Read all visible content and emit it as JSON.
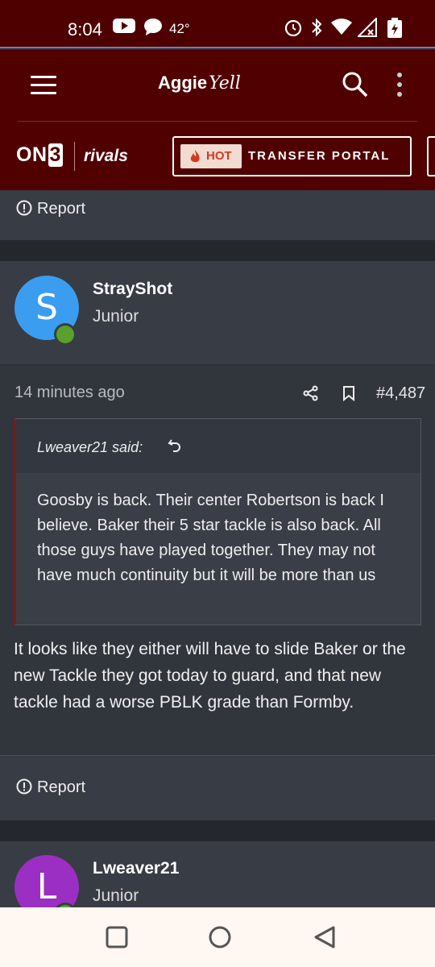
{
  "status_bar": {
    "time": "8:04",
    "temperature": "42°",
    "icons": [
      "youtube-icon",
      "chat-icon",
      "alarm-icon",
      "bluetooth-icon",
      "wifi-icon",
      "signal-icon",
      "battery-icon"
    ]
  },
  "header": {
    "logo_part1": "Aggie",
    "logo_part2": "Yell",
    "on3_text": "ON",
    "on3_digit": "3",
    "rivals_text": "rivals",
    "hot_badge": "HOT",
    "portal_label": "TRANSFER PORTAL"
  },
  "report_label": "Report",
  "posts": [
    {
      "username": "StrayShot",
      "rank": "Junior",
      "avatar_letter": "S",
      "avatar_color": "#3a9df0",
      "time_ago": "14 minutes ago",
      "post_number": "#4,487",
      "quote": {
        "author": "Lweaver21 said:",
        "text": "Goosby is back. Their center Robertson is back I believe. Baker their 5 star tackle is also back. All those guys have played together. They may not have much continuity but it will be more than us"
      },
      "body": "It looks like they either will have to slide Baker or the new Tackle they got today to guard, and that new tackle had a worse PBLK grade than Formby."
    },
    {
      "username": "Lweaver21",
      "rank": "Junior",
      "avatar_letter": "L",
      "avatar_color": "#9b2fc3"
    }
  ],
  "colors": {
    "header_bg": "#510000",
    "content_bg": "#383c44",
    "online_green": "#5aa02c"
  }
}
